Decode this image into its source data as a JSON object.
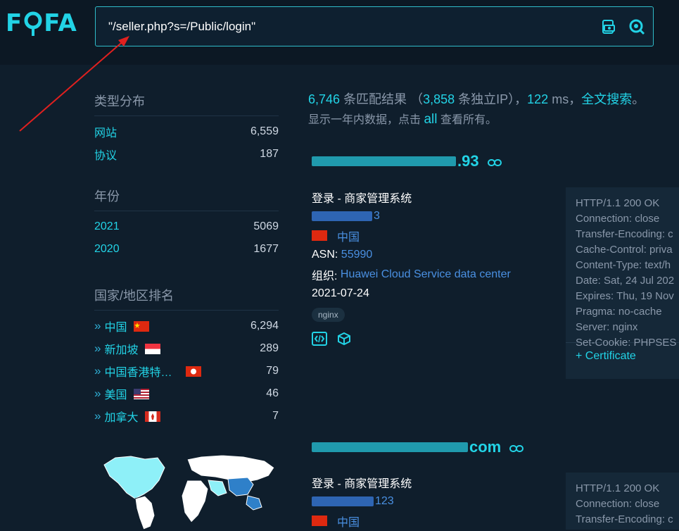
{
  "logo": {
    "text_f": "F",
    "text_fa": "FA"
  },
  "search": {
    "query": "\"/seller.php?s=/Public/login\"",
    "icons": [
      "file-upload-icon",
      "search-icon"
    ]
  },
  "stats": {
    "count": "6,746",
    "count_label": "条匹配结果",
    "ip_count": "3,858",
    "ip_label": "条独立IP",
    "ms": "122",
    "ms_label": "ms",
    "fulltext": "全文搜索",
    "sub_prefix": "显示一年内数据，点击",
    "sub_all": "all",
    "sub_suffix": "查看所有。"
  },
  "sidebar": {
    "type_title": "类型分布",
    "types": [
      {
        "label": "网站",
        "value": "6,559"
      },
      {
        "label": "协议",
        "value": "187"
      }
    ],
    "year_title": "年份",
    "years": [
      {
        "label": "2021",
        "value": "5069"
      },
      {
        "label": "2020",
        "value": "1677"
      }
    ],
    "country_title": "国家/地区排名",
    "countries": [
      {
        "label": "中国",
        "value": "6,294",
        "flag": "cn"
      },
      {
        "label": "新加坡",
        "value": "289",
        "flag": "sg"
      },
      {
        "label": "中国香港特…",
        "value": "79",
        "flag": "hk"
      },
      {
        "label": "美国",
        "value": "46",
        "flag": "us"
      },
      {
        "label": "加拿大",
        "value": "7",
        "flag": "ca"
      }
    ]
  },
  "results": [
    {
      "title_suffix": ".93",
      "page_title": "登录 - 商家管理系统",
      "ip_suffix": "3",
      "country": "中国",
      "asn_label": "ASN:",
      "asn": "55990",
      "org_label": "组织:",
      "org": "Huawei Cloud Service data center",
      "date": "2021-07-24",
      "tag": "nginx",
      "header_lines": [
        "HTTP/1.1 200 OK",
        "Connection: close",
        "Transfer-Encoding: c",
        "Cache-Control: priva",
        "Content-Type: text/h",
        "Date: Sat, 24 Jul 202",
        "Expires: Thu, 19 Nov",
        "Pragma: no-cache",
        "Server: nginx",
        "Set-Cookie: PHPSES"
      ],
      "cert_label": "+ Certificate"
    },
    {
      "title_suffix": "com",
      "page_title": "登录 - 商家管理系统",
      "ip_suffix": "123",
      "country": "中国",
      "header_lines": [
        "HTTP/1.1 200 OK",
        "Connection: close",
        "Transfer-Encoding: c"
      ]
    }
  ],
  "colors": {
    "accent": "#22d3e6",
    "link": "#4a90e2",
    "background": "#0f1e2c",
    "arrow": "#e0201f"
  }
}
